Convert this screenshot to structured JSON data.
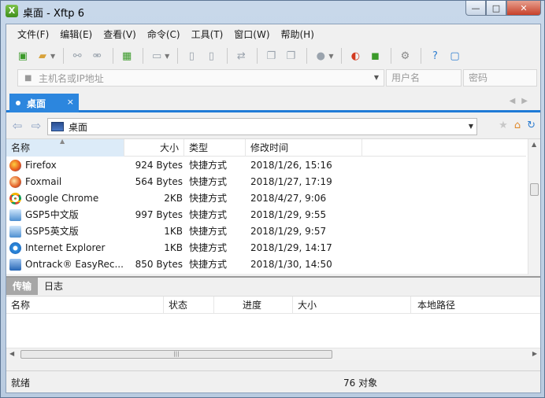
{
  "window": {
    "title": "桌面 - Xftp 6",
    "min": "—",
    "max": "□",
    "close": "✕"
  },
  "menu": [
    "文件(F)",
    "编辑(E)",
    "查看(V)",
    "命令(C)",
    "工具(T)",
    "窗口(W)",
    "帮助(H)"
  ],
  "host": {
    "placeholder": "主机名或IP地址",
    "user_placeholder": "用户名",
    "pass_placeholder": "密码"
  },
  "tab": {
    "label": "桌面",
    "close": "×"
  },
  "path": {
    "value": "桌面"
  },
  "columns": {
    "name": "名称",
    "size": "大小",
    "type": "类型",
    "mtime": "修改时间"
  },
  "files": [
    {
      "icon": "firefox",
      "name": "Firefox",
      "size": "924 Bytes",
      "type": "快捷方式",
      "mtime": "2018/1/26, 15:16"
    },
    {
      "icon": "foxmail",
      "name": "Foxmail",
      "size": "564 Bytes",
      "type": "快捷方式",
      "mtime": "2018/1/27, 17:19"
    },
    {
      "icon": "chrome",
      "name": "Google Chrome",
      "size": "2KB",
      "type": "快捷方式",
      "mtime": "2018/4/27, 9:06"
    },
    {
      "icon": "gsp",
      "name": "GSP5中文版",
      "size": "997 Bytes",
      "type": "快捷方式",
      "mtime": "2018/1/29, 9:55"
    },
    {
      "icon": "gsp",
      "name": "GSP5英文版",
      "size": "1KB",
      "type": "快捷方式",
      "mtime": "2018/1/29, 9:57"
    },
    {
      "icon": "ie",
      "name": "Internet Explorer",
      "size": "1KB",
      "type": "快捷方式",
      "mtime": "2018/1/29, 14:17"
    },
    {
      "icon": "ontrack",
      "name": "Ontrack® EasyRec...",
      "size": "850 Bytes",
      "type": "快捷方式",
      "mtime": "2018/1/30, 14:50"
    }
  ],
  "pane_tabs": {
    "transfer": "传输",
    "log": "日志"
  },
  "transfer_columns": {
    "name": "名称",
    "status": "状态",
    "progress": "进度",
    "size": "大小",
    "local_path": "本地路径"
  },
  "status": {
    "left": "就绪",
    "right": "76 对象"
  },
  "colors": {
    "tab_blue": "#2c86de",
    "accent_green": "#3b9a2a",
    "accent_red": "#d33a1f"
  }
}
